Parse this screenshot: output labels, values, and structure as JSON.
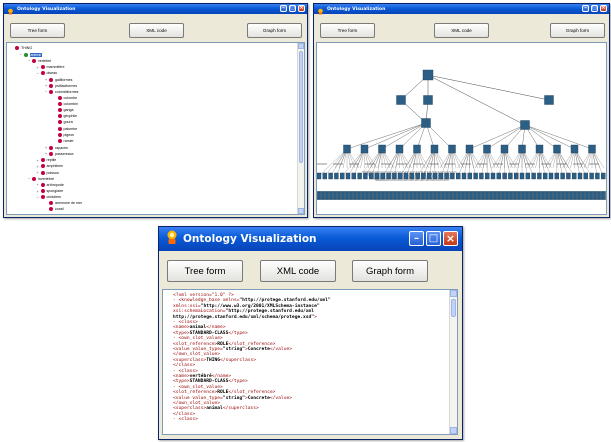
{
  "windows": {
    "tree": {
      "title": "Ontology Visualization",
      "buttons": {
        "tree": "Tree form",
        "xml": "XML code",
        "graph": "Graph form"
      }
    },
    "graph": {
      "title": "Ontology Visualization",
      "buttons": {
        "tree": "Tree form",
        "xml": "XML code",
        "graph": "Graph form"
      }
    },
    "xml": {
      "title": "Ontology Visualization",
      "buttons": {
        "tree": "Tree form",
        "xml": "XML code",
        "graph": "Graph form"
      }
    }
  },
  "tree_items": [
    {
      "label": "THING",
      "indent": 0,
      "expander": "",
      "highlight": false
    },
    {
      "label": "animal",
      "indent": 1,
      "expander": "−",
      "highlight": true
    },
    {
      "label": "vertébré",
      "indent": 2,
      "expander": "−",
      "highlight": false
    },
    {
      "label": "mammifère",
      "indent": 3,
      "expander": "+",
      "highlight": false
    },
    {
      "label": "oiseau",
      "indent": 3,
      "expander": "−",
      "highlight": false
    },
    {
      "label": "galliformes",
      "indent": 4,
      "expander": "+",
      "highlight": false
    },
    {
      "label": "psittaciformes",
      "indent": 4,
      "expander": "+",
      "highlight": false
    },
    {
      "label": "colombiformes",
      "indent": 4,
      "expander": "−",
      "highlight": false
    },
    {
      "label": "colombe",
      "indent": 5,
      "expander": "",
      "highlight": false
    },
    {
      "label": "colombin",
      "indent": 5,
      "expander": "",
      "highlight": false
    },
    {
      "label": "ganga",
      "indent": 5,
      "expander": "",
      "highlight": false
    },
    {
      "label": "géophile",
      "indent": 5,
      "expander": "",
      "highlight": false
    },
    {
      "label": "goura",
      "indent": 5,
      "expander": "",
      "highlight": false
    },
    {
      "label": "palombe",
      "indent": 5,
      "expander": "",
      "highlight": false
    },
    {
      "label": "pigeon",
      "indent": 5,
      "expander": "",
      "highlight": false
    },
    {
      "label": "ramier",
      "indent": 5,
      "expander": "",
      "highlight": false
    },
    {
      "label": "rapaces",
      "indent": 4,
      "expander": "+",
      "highlight": false
    },
    {
      "label": "passereaux",
      "indent": 4,
      "expander": "+",
      "highlight": false
    },
    {
      "label": "reptile",
      "indent": 3,
      "expander": "+",
      "highlight": false
    },
    {
      "label": "amphibien",
      "indent": 3,
      "expander": "+",
      "highlight": false
    },
    {
      "label": "poisson",
      "indent": 3,
      "expander": "+",
      "highlight": false
    },
    {
      "label": "invertébré",
      "indent": 2,
      "expander": "−",
      "highlight": false
    },
    {
      "label": "arthropode",
      "indent": 3,
      "expander": "+",
      "highlight": false
    },
    {
      "label": "spongiaire",
      "indent": 3,
      "expander": "+",
      "highlight": false
    },
    {
      "label": "cnidaires",
      "indent": 3,
      "expander": "−",
      "highlight": false
    },
    {
      "label": "anemone de mer",
      "indent": 4,
      "expander": "",
      "highlight": false
    },
    {
      "label": "corail",
      "indent": 4,
      "expander": "",
      "highlight": false
    }
  ],
  "xml_lines": [
    [
      {
        "t": "tag",
        "s": "<?xml version=\"1.0\" ?>"
      }
    ],
    [
      {
        "t": "tag",
        "s": "- <knowledge_base xmlns="
      },
      {
        "t": "val",
        "s": "\"http://protege.stanford.edu/xml\""
      }
    ],
    [
      {
        "t": "tag",
        "s": "    xmlns:xsi="
      },
      {
        "t": "val",
        "s": "\"http://www.w3.org/2001/XMLSchema-instance\""
      }
    ],
    [
      {
        "t": "tag",
        "s": "    xsi:schemaLocation="
      },
      {
        "t": "val",
        "s": "\"http://protege.stanford.edu/xml"
      }
    ],
    [
      {
        "t": "val",
        "s": "    http://protege.stanford.edu/xml/schema/protege.xsd\""
      },
      {
        "t": "tag",
        "s": ">"
      }
    ],
    [
      {
        "t": "tag",
        "s": "  - <class>"
      }
    ],
    [
      {
        "t": "tag",
        "s": "      <name>"
      },
      {
        "t": "val",
        "s": "animal"
      },
      {
        "t": "tag",
        "s": "</name>"
      }
    ],
    [
      {
        "t": "tag",
        "s": "      <type>"
      },
      {
        "t": "val",
        "s": "STANDARD-CLASS"
      },
      {
        "t": "tag",
        "s": "</type>"
      }
    ],
    [
      {
        "t": "tag",
        "s": "    - <own_slot_value>"
      }
    ],
    [
      {
        "t": "tag",
        "s": "        <slot_reference>"
      },
      {
        "t": "val",
        "s": "ROLE"
      },
      {
        "t": "tag",
        "s": "</slot_reference>"
      }
    ],
    [
      {
        "t": "tag",
        "s": "        <value value_type="
      },
      {
        "t": "val",
        "s": "\"string\""
      },
      {
        "t": "tag",
        "s": ">"
      },
      {
        "t": "val",
        "s": "Concrete"
      },
      {
        "t": "tag",
        "s": "</value>"
      }
    ],
    [
      {
        "t": "tag",
        "s": "      </own_slot_value>"
      }
    ],
    [
      {
        "t": "tag",
        "s": "      <superclass>"
      },
      {
        "t": "val",
        "s": "THING"
      },
      {
        "t": "tag",
        "s": "</superclass>"
      }
    ],
    [
      {
        "t": "tag",
        "s": "    </class>"
      }
    ],
    [
      {
        "t": "tag",
        "s": "  - <class>"
      }
    ],
    [
      {
        "t": "tag",
        "s": "      <name>"
      },
      {
        "t": "val",
        "s": "vertébré"
      },
      {
        "t": "tag",
        "s": "</name>"
      }
    ],
    [
      {
        "t": "tag",
        "s": "      <type>"
      },
      {
        "t": "val",
        "s": "STANDARD-CLASS"
      },
      {
        "t": "tag",
        "s": "</type>"
      }
    ],
    [
      {
        "t": "tag",
        "s": "    - <own_slot_value>"
      }
    ],
    [
      {
        "t": "tag",
        "s": "        <slot_reference>"
      },
      {
        "t": "val",
        "s": "ROLE"
      },
      {
        "t": "tag",
        "s": "</slot_reference>"
      }
    ],
    [
      {
        "t": "tag",
        "s": "        <value value_type="
      },
      {
        "t": "val",
        "s": "\"string\""
      },
      {
        "t": "tag",
        "s": ">"
      },
      {
        "t": "val",
        "s": "Concrete"
      },
      {
        "t": "tag",
        "s": "</value>"
      }
    ],
    [
      {
        "t": "tag",
        "s": "      </own_slot_value>"
      }
    ],
    [
      {
        "t": "tag",
        "s": "      <superclass>"
      },
      {
        "t": "val",
        "s": "animal"
      },
      {
        "t": "tag",
        "s": "</superclass>"
      }
    ],
    [
      {
        "t": "tag",
        "s": "    </class>"
      }
    ],
    [
      {
        "t": "tag",
        "s": "  - <class>"
      }
    ]
  ],
  "colors": {
    "titlebar": "#0a5bd6",
    "node_fill": "#2b5f86",
    "bullet": "#c5003e",
    "highlight_bullet": "#2e8b2e"
  },
  "icons": {
    "app": "ontology-app-icon",
    "minimize": "minimize-icon",
    "maximize": "maximize-icon",
    "close": "close-icon"
  }
}
